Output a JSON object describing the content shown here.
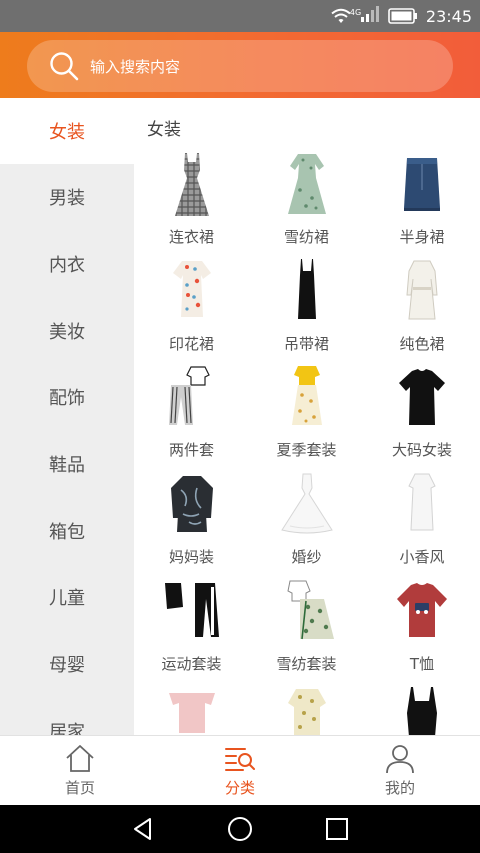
{
  "status_bar": {
    "time": "23:45",
    "network": "4G"
  },
  "search": {
    "placeholder": "输入搜索内容"
  },
  "sidebar": {
    "items": [
      {
        "label": "女装",
        "active": true
      },
      {
        "label": "男装"
      },
      {
        "label": "内衣"
      },
      {
        "label": "美妆"
      },
      {
        "label": "配饰"
      },
      {
        "label": "鞋品"
      },
      {
        "label": "箱包"
      },
      {
        "label": "儿童"
      },
      {
        "label": "母婴"
      },
      {
        "label": "居家"
      }
    ]
  },
  "content": {
    "section_title": "女装",
    "items": [
      {
        "label": "连衣裙",
        "image": "plaid-dress-icon"
      },
      {
        "label": "雪纺裙",
        "image": "chiffon-dress-icon"
      },
      {
        "label": "半身裙",
        "image": "denim-skirt-icon"
      },
      {
        "label": "印花裙",
        "image": "print-dress-icon"
      },
      {
        "label": "吊带裙",
        "image": "slip-dress-icon"
      },
      {
        "label": "纯色裙",
        "image": "white-dress-icon"
      },
      {
        "label": "两件套",
        "image": "two-piece-set-icon"
      },
      {
        "label": "夏季套装",
        "image": "summer-set-icon"
      },
      {
        "label": "大码女装",
        "image": "black-tee-icon"
      },
      {
        "label": "妈妈装",
        "image": "mom-blouse-icon"
      },
      {
        "label": "婚纱",
        "image": "wedding-dress-icon"
      },
      {
        "label": "小香风",
        "image": "white-shift-dress-icon"
      },
      {
        "label": "运动套装",
        "image": "sport-set-icon"
      },
      {
        "label": "雪纺套装",
        "image": "chiffon-set-icon"
      },
      {
        "label": "T恤",
        "image": "red-tshirt-icon"
      },
      {
        "label": "",
        "image": "pink-offshoulder-top-icon"
      },
      {
        "label": "",
        "image": "floral-top-icon"
      },
      {
        "label": "",
        "image": "black-camisole-icon"
      }
    ]
  },
  "bottom_nav": {
    "items": [
      {
        "label": "首页",
        "icon": "home-icon"
      },
      {
        "label": "分类",
        "icon": "category-icon",
        "active": true
      },
      {
        "label": "我的",
        "icon": "profile-icon"
      }
    ]
  },
  "colors": {
    "accent": "#e8541f",
    "header_gradient_start": "#ee7c1c",
    "header_gradient_end": "#f25d3a",
    "sidebar_bg": "#eeeeee"
  }
}
